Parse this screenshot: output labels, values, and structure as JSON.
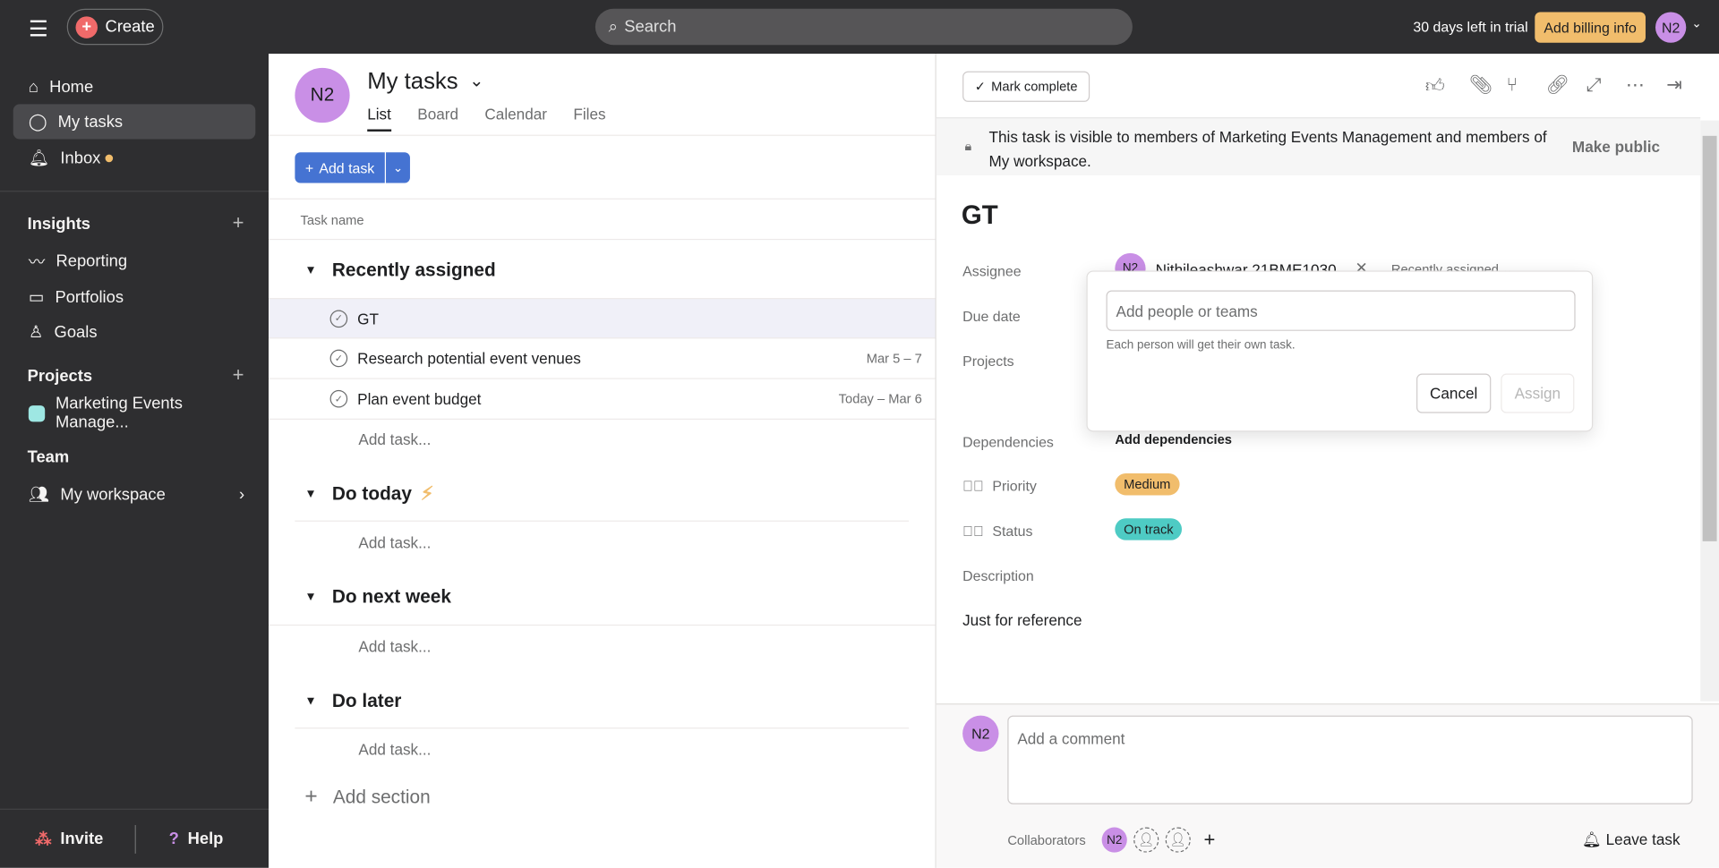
{
  "topbar": {
    "create": "Create",
    "search_placeholder": "Search",
    "trial": "30 days left in trial",
    "billing": "Add billing info",
    "avatar": "N2"
  },
  "sidebar": {
    "items": [
      {
        "label": "Home"
      },
      {
        "label": "My tasks"
      },
      {
        "label": "Inbox"
      }
    ],
    "insights": "Insights",
    "insight_items": [
      {
        "label": "Reporting"
      },
      {
        "label": "Portfolios"
      },
      {
        "label": "Goals"
      }
    ],
    "projects": "Projects",
    "project_items": [
      {
        "label": "Marketing Events Manage...",
        "color": "#9ee7e3"
      }
    ],
    "team": "Team",
    "team_items": [
      {
        "label": "My workspace"
      }
    ],
    "invite": "Invite",
    "help": "Help"
  },
  "list": {
    "avatar": "N2",
    "title": "My tasks",
    "tabs": [
      "List",
      "Board",
      "Calendar",
      "Files"
    ],
    "add_task": "Add task",
    "col_task_name": "Task name",
    "sections": [
      {
        "name": "Recently assigned",
        "tasks": [
          {
            "name": "GT",
            "date": ""
          },
          {
            "name": "Research potential event venues",
            "date": "Mar 5 – 7"
          },
          {
            "name": "Plan event budget",
            "date": "Today – Mar 6"
          }
        ]
      },
      {
        "name": "Do today"
      },
      {
        "name": "Do next week"
      },
      {
        "name": "Do later"
      }
    ],
    "add_task_placeholder": "Add task...",
    "add_section": "Add section"
  },
  "detail": {
    "mark_complete": "Mark complete",
    "visibility": "This task is visible to members of Marketing Events Management and members of My workspace.",
    "make_public": "Make public",
    "title": "GT",
    "labels": {
      "assignee": "Assignee",
      "due": "Due date",
      "projects": "Projects",
      "deps": "Dependencies",
      "priority": "Priority",
      "status": "Status",
      "description": "Description"
    },
    "assignee_avatar": "N2",
    "assignee_name": "Nithileashwar 21BME1030",
    "recently_assigned": "Recently assigned",
    "add_deps": "Add dependencies",
    "priority": "Medium",
    "priority_color": "#f1bd6c",
    "status": "On track",
    "status_color": "#4ecbc4",
    "description": "Just for reference",
    "popup": {
      "placeholder": "Add people or teams",
      "hint": "Each person will get their own task.",
      "cancel": "Cancel",
      "assign": "Assign"
    },
    "comment_avatar": "N2",
    "comment_placeholder": "Add a comment",
    "collaborators": "Collaborators",
    "collab_avatar": "N2",
    "leave": "Leave task"
  }
}
